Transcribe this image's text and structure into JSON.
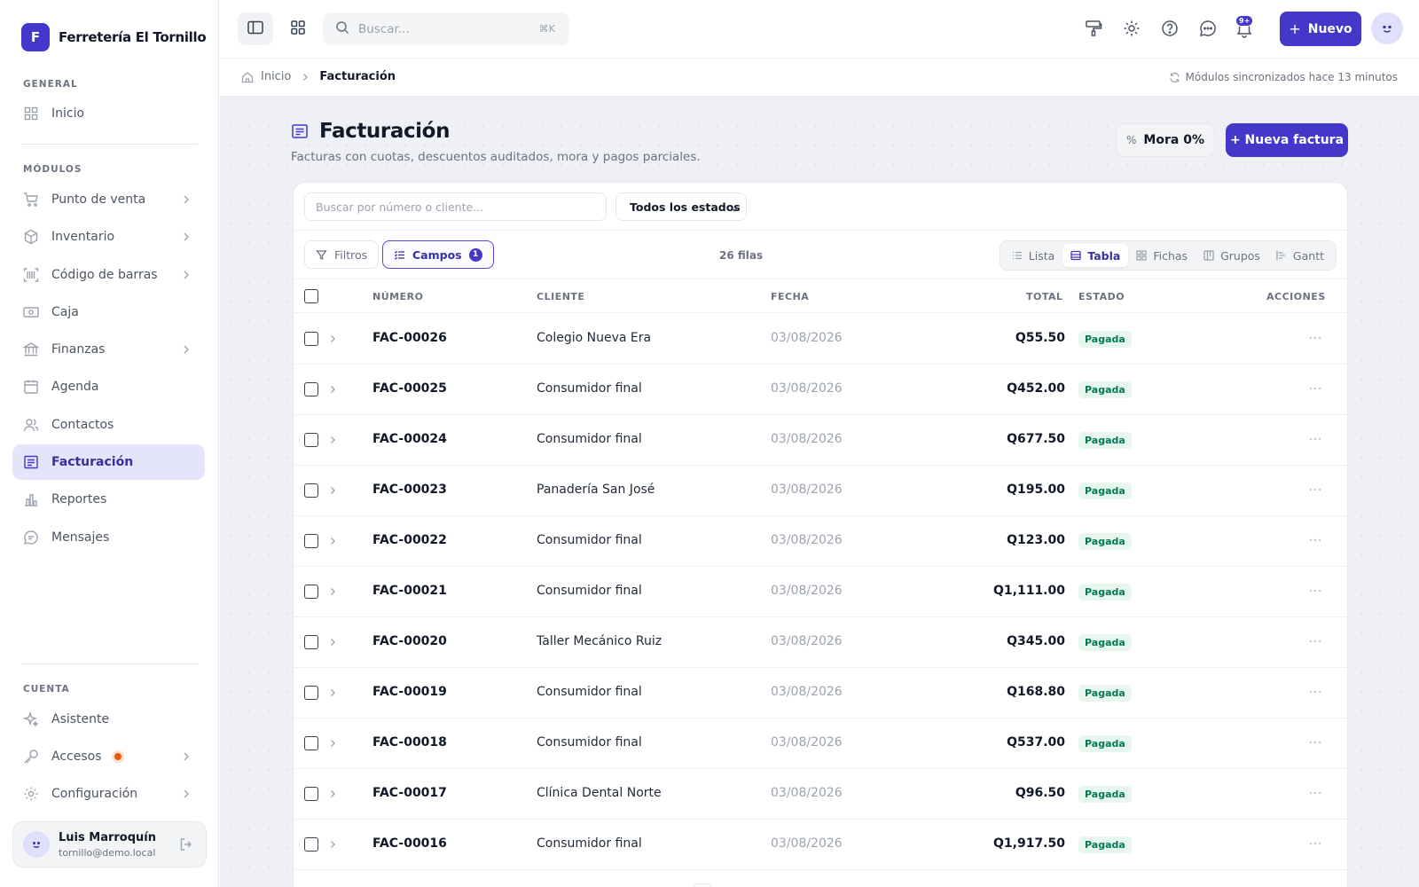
{
  "brand": {
    "letter": "F",
    "name": "Ferretería El Tornillo"
  },
  "sidebar": {
    "general_label": "GENERAL",
    "general_items": [
      {
        "label": "Inicio",
        "icon": "grid-icon"
      }
    ],
    "modules_label": "MÓDULOS",
    "module_items": [
      {
        "label": "Punto de venta",
        "icon": "cart-icon",
        "chevron": true
      },
      {
        "label": "Inventario",
        "icon": "box-icon",
        "chevron": true
      },
      {
        "label": "Código de barras",
        "icon": "barcode-icon",
        "chevron": true
      },
      {
        "label": "Caja",
        "icon": "cash-icon"
      },
      {
        "label": "Finanzas",
        "icon": "bank-icon",
        "chevron": true
      },
      {
        "label": "Agenda",
        "icon": "calendar-icon"
      },
      {
        "label": "Contactos",
        "icon": "users-icon"
      },
      {
        "label": "Facturación",
        "icon": "invoice-icon",
        "active": true
      },
      {
        "label": "Reportes",
        "icon": "bar-chart-icon"
      },
      {
        "label": "Mensajes",
        "icon": "message-icon"
      }
    ],
    "account_label": "CUENTA",
    "account_items": [
      {
        "label": "Asistente",
        "icon": "sparkle-icon"
      },
      {
        "label": "Accesos",
        "icon": "key-icon",
        "chevron": true,
        "dot": true
      },
      {
        "label": "Configuración",
        "icon": "gear-icon",
        "chevron": true
      }
    ],
    "user": {
      "name": "Luis Marroquín",
      "email": "tornillo@demo.local"
    }
  },
  "topbar": {
    "search_placeholder": "Buscar...",
    "search_shortcut": "⌘K",
    "notif_count": "9+",
    "new_label": "Nuevo"
  },
  "breadcrumb": {
    "home": "Inicio",
    "current": "Facturación",
    "sync": "Módulos sincronizados hace 13 minutos"
  },
  "page": {
    "title": "Facturación",
    "subtitle": "Facturas con cuotas, descuentos auditados, mora y pagos parciales.",
    "mora_label": "Mora 0%",
    "mora_icon": "%",
    "new_invoice_label": "+ Nueva factura"
  },
  "filters": {
    "search_placeholder": "Buscar por número o cliente...",
    "state_select": "Todos los estados",
    "filtros_label": "Filtros",
    "campos_label": "Campos",
    "campos_count": "1",
    "rows_count": "26 filas"
  },
  "views": [
    {
      "label": "Lista",
      "icon": "list-icon"
    },
    {
      "label": "Tabla",
      "icon": "table-icon",
      "active": true
    },
    {
      "label": "Fichas",
      "icon": "cards-icon"
    },
    {
      "label": "Grupos",
      "icon": "kanban-icon"
    },
    {
      "label": "Gantt",
      "icon": "gantt-icon"
    }
  ],
  "table": {
    "columns": {
      "numero": "NÚMERO",
      "cliente": "CLIENTE",
      "fecha": "FECHA",
      "total": "TOTAL",
      "estado": "ESTADO",
      "acciones": "ACCIONES"
    },
    "rows": [
      {
        "numero": "FAC-00026",
        "cliente": "Colegio Nueva Era",
        "fecha": "03/08/2026",
        "total": "Q55.50",
        "estado": "Pagada"
      },
      {
        "numero": "FAC-00025",
        "cliente": "Consumidor final",
        "fecha": "03/08/2026",
        "total": "Q452.00",
        "estado": "Pagada"
      },
      {
        "numero": "FAC-00024",
        "cliente": "Consumidor final",
        "fecha": "03/08/2026",
        "total": "Q677.50",
        "estado": "Pagada"
      },
      {
        "numero": "FAC-00023",
        "cliente": "Panadería San José",
        "fecha": "03/08/2026",
        "total": "Q195.00",
        "estado": "Pagada"
      },
      {
        "numero": "FAC-00022",
        "cliente": "Consumidor final",
        "fecha": "03/08/2026",
        "total": "Q123.00",
        "estado": "Pagada"
      },
      {
        "numero": "FAC-00021",
        "cliente": "Consumidor final",
        "fecha": "03/08/2026",
        "total": "Q1,111.00",
        "estado": "Pagada"
      },
      {
        "numero": "FAC-00020",
        "cliente": "Taller Mecánico Ruiz",
        "fecha": "03/08/2026",
        "total": "Q345.00",
        "estado": "Pagada"
      },
      {
        "numero": "FAC-00019",
        "cliente": "Consumidor final",
        "fecha": "03/08/2026",
        "total": "Q168.80",
        "estado": "Pagada"
      },
      {
        "numero": "FAC-00018",
        "cliente": "Consumidor final",
        "fecha": "03/08/2026",
        "total": "Q537.00",
        "estado": "Pagada"
      },
      {
        "numero": "FAC-00017",
        "cliente": "Clínica Dental Norte",
        "fecha": "03/08/2026",
        "total": "Q96.50",
        "estado": "Pagada"
      },
      {
        "numero": "FAC-00016",
        "cliente": "Consumidor final",
        "fecha": "03/08/2026",
        "total": "Q1,917.50",
        "estado": "Pagada"
      }
    ]
  },
  "colors": {
    "accent": "#4338ca",
    "active_bg": "#e4e5fa",
    "paid_bg": "#e7f7ee",
    "paid_text": "#047857"
  }
}
